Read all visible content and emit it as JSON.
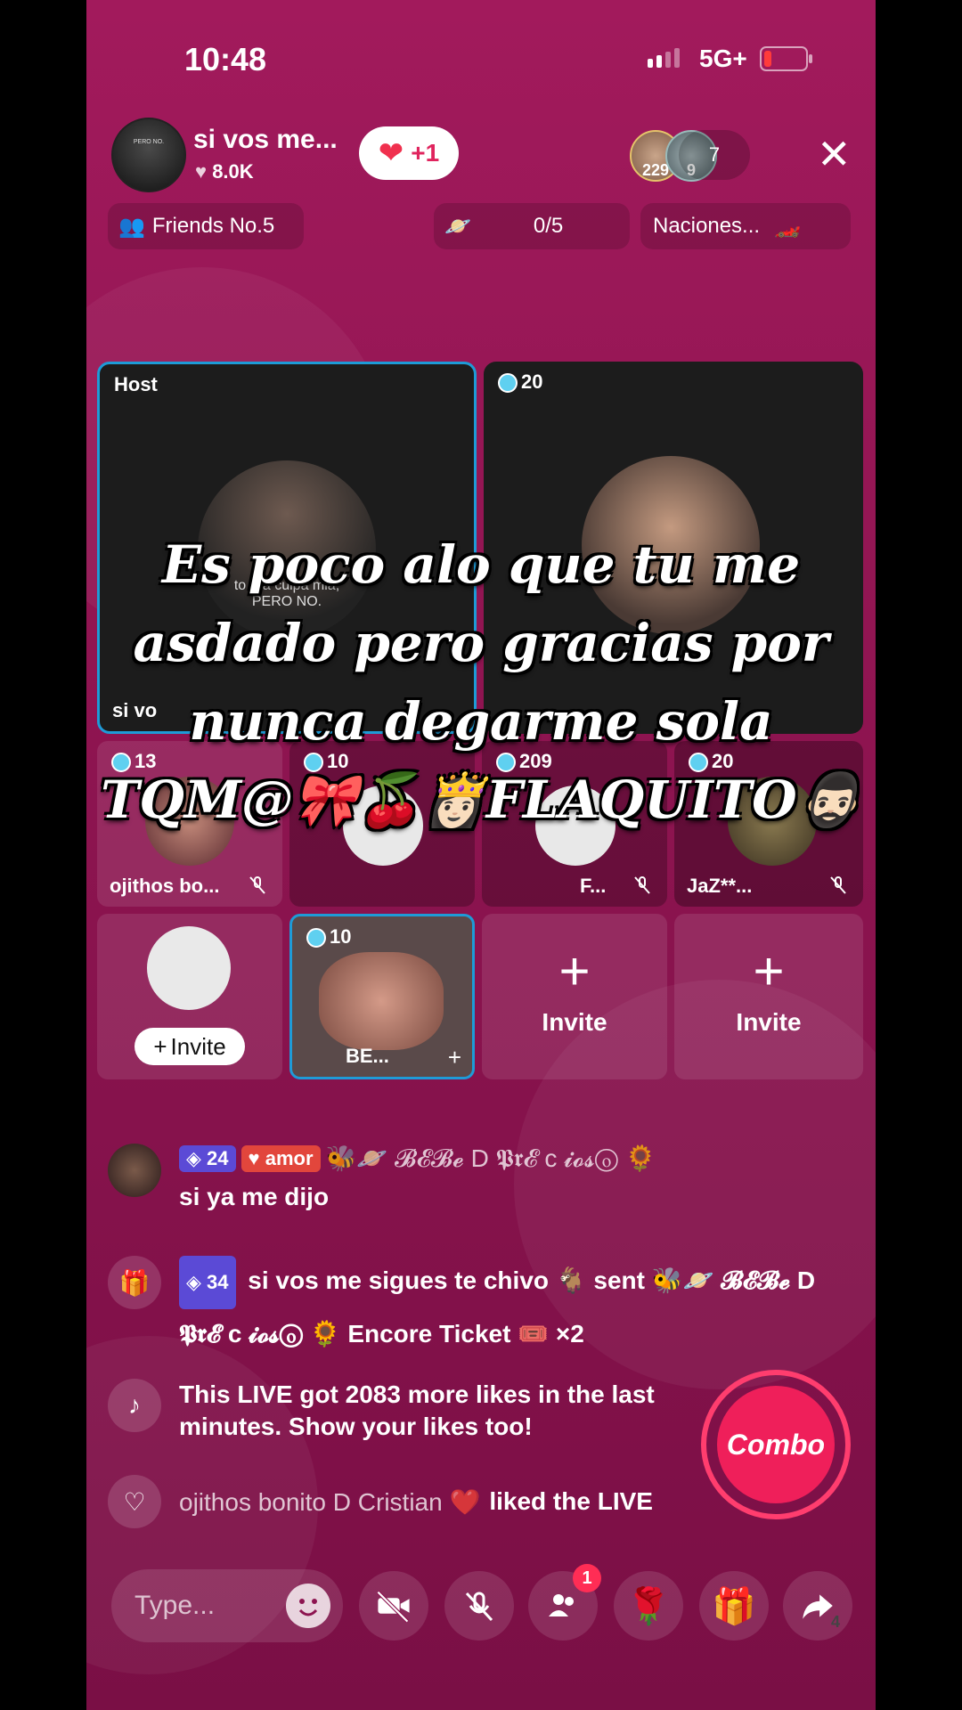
{
  "status_bar": {
    "time": "10:48",
    "network": "5G+"
  },
  "host": {
    "name": "si vos me...",
    "likes": "8.0K",
    "follow_plus": "+1",
    "avatar_text": "PERO NO."
  },
  "viewers": {
    "avatar1_badge": "229",
    "avatar2_badge": "9",
    "count": "7"
  },
  "chips": {
    "friends": "Friends No.5",
    "progress": "0/5",
    "naciones": "Naciones..."
  },
  "tiles": {
    "host_label": "Host",
    "host_name": "si vo",
    "host_caption": "to era culpa mia, PERO NO.",
    "guest1_score": "20",
    "guest2_score": "13",
    "guest2_name": "ojithos bo...",
    "guest3_score": "10",
    "guest4_score": "209",
    "guest4_name": "F...",
    "guest5_score": "20",
    "guest5_name": "JaZ**...",
    "guest6_score": "10",
    "guest6_name": "BE...",
    "invite_label": "Invite",
    "invite_pill_label": "Invite"
  },
  "overlay_text": {
    "line1": "Es poco alo que tu me",
    "line2": "asdado pero gracias por",
    "line3": "nunca degarme sola",
    "line4": "TQM@🎀🍒👸🏻FLAQUITO🧔🏻‍♂️"
  },
  "chat": [
    {
      "gem_level": "24",
      "badge": "amor",
      "name": "🐝🪐 𝓑𝓔𝓑𝓮 D 𝕻𝖗𝓔 c 𝓲𝓸𝓼ⓞ 🌻",
      "text": "si ya me dijo"
    },
    {
      "gem_level": "34",
      "text": "si vos me sigues te chivo 🐐 sent 🐝🪐 𝓑𝓔𝓑𝓮 D 𝕻𝖗𝓔 c 𝓲𝓸𝓼ⓞ 🌻 Encore Ticket 🎟️ ×2"
    },
    {
      "text": "This LIVE got 2083 more likes in the last minutes. Show your likes too!"
    },
    {
      "name": "ojithos bonito D Cristian ❤️",
      "text": "liked the LIVE"
    }
  ],
  "combo_label": "Combo",
  "bottom_bar": {
    "type_placeholder": "Type...",
    "notif_count": "1",
    "share_count": "4"
  },
  "icons": [
    "heart-icon",
    "close-icon",
    "group-icon",
    "planet-icon",
    "car-icon",
    "mute-icon",
    "plus-icon",
    "user-icon",
    "gift-icon",
    "tiktok-icon",
    "emoji-icon",
    "camera-off-icon",
    "mic-off-icon",
    "users-icon",
    "rose-icon",
    "share-icon"
  ],
  "colors": {
    "background": "#8d1450",
    "accent": "#ef1f5a",
    "tile_border": "#1e9bd7"
  }
}
